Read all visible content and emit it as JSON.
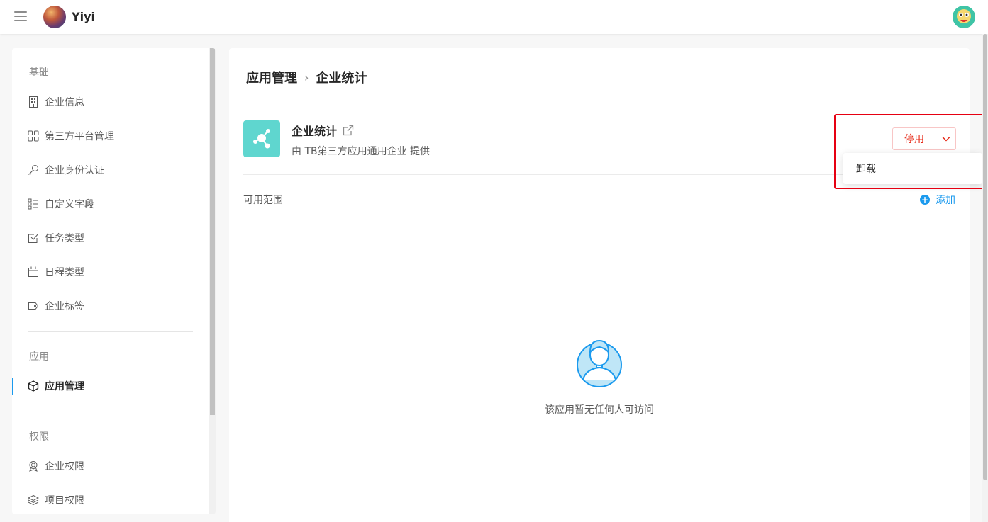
{
  "topbar": {
    "org_name": "Yiyi"
  },
  "sidebar": {
    "groups": [
      {
        "title": "基础",
        "items": [
          "企业信息",
          "第三方平台管理",
          "企业身份认证",
          "自定义字段",
          "任务类型",
          "日程类型",
          "企业标签"
        ]
      },
      {
        "title": "应用",
        "items": [
          "应用管理"
        ]
      },
      {
        "title": "权限",
        "items": [
          "企业权限",
          "项目权限"
        ]
      }
    ]
  },
  "breadcrumb": {
    "parent": "应用管理",
    "separator": "›",
    "current": "企业统计"
  },
  "app": {
    "name": "企业统计",
    "provider": "由 TB第三方应用通用企业 提供"
  },
  "actions": {
    "disable_label": "停用",
    "dropdown_items": [
      "卸载"
    ]
  },
  "scope": {
    "label": "可用范围",
    "add_label": "添加"
  },
  "empty_state": {
    "text": "该应用暂无任何人可访问"
  },
  "colors": {
    "accent": "#1b9aee",
    "danger": "#e62412",
    "app_icon_bg": "#5fd6cf"
  }
}
